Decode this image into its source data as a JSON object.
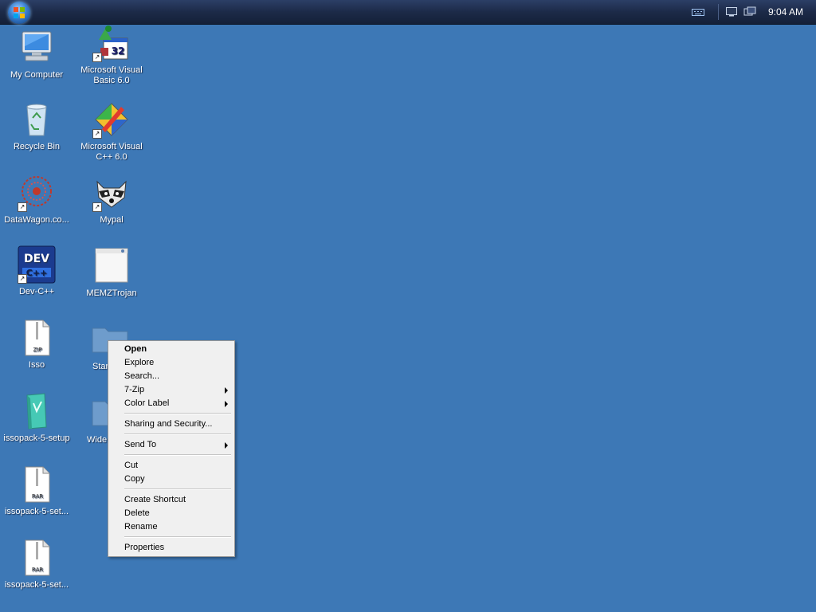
{
  "taskbar": {
    "clock": "9:04 AM"
  },
  "desktop_icons": [
    {
      "label": "My Computer",
      "icon": "computer-icon"
    },
    {
      "label": "Microsoft Visual Basic 6.0",
      "icon": "vb6-icon"
    },
    {
      "label": "Recycle Bin",
      "icon": "recycle-bin-icon"
    },
    {
      "label": "Microsoft Visual C++ 6.0",
      "icon": "vc6-icon"
    },
    {
      "label": "DataWagon.co...",
      "icon": "datawagon-icon"
    },
    {
      "label": "Mypal",
      "icon": "mypal-icon"
    },
    {
      "label": "Dev-C++",
      "icon": "devcpp-icon"
    },
    {
      "label": "MEMZTrojan",
      "icon": "window-icon"
    },
    {
      "label": "Isso",
      "icon": "zip-file-icon"
    },
    {
      "label": "Star",
      "icon": "folder-icon"
    },
    {
      "label": "issopack-5-setup",
      "icon": "setup-icon"
    },
    {
      "label": "Wide",
      "icon": "folder-icon"
    },
    {
      "label": "issopack-5-set...",
      "icon": "rar-file-icon"
    },
    {
      "label": "issopack-5-set...",
      "icon": "rar-file-icon"
    }
  ],
  "context_menu": {
    "items": [
      {
        "label": "Open",
        "bold": true
      },
      {
        "label": "Explore"
      },
      {
        "label": "Search..."
      },
      {
        "label": "7-Zip",
        "submenu": true
      },
      {
        "label": "Color Label",
        "submenu": true
      },
      {
        "label": "Sharing and Security..."
      },
      {
        "label": "Send To",
        "submenu": true
      },
      {
        "label": "Cut"
      },
      {
        "label": "Copy"
      },
      {
        "label": "Create Shortcut"
      },
      {
        "label": "Delete"
      },
      {
        "label": "Rename"
      },
      {
        "label": "Properties"
      }
    ]
  },
  "colors": {
    "desktop": "#3d78b6",
    "taskbar": "#1c2a48",
    "menu_bg": "#f0f0f0"
  }
}
